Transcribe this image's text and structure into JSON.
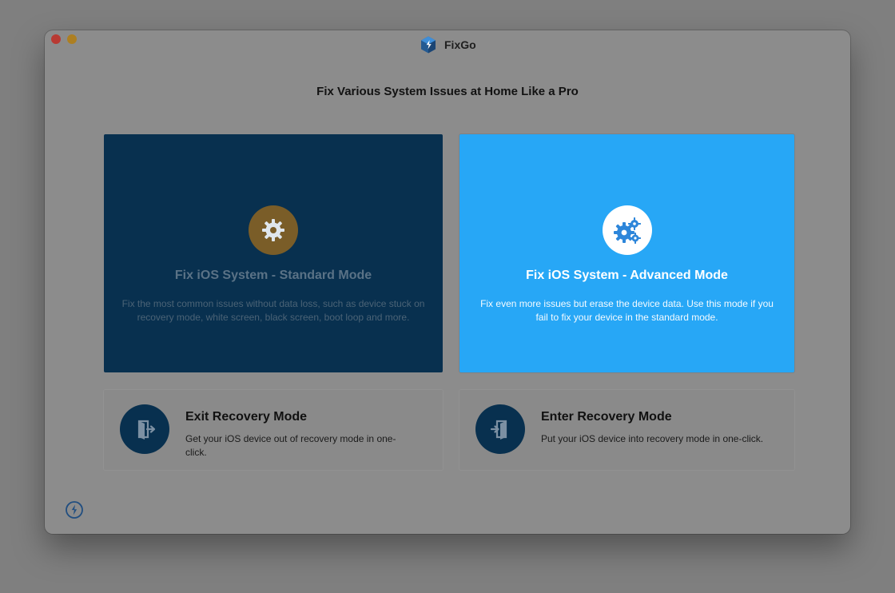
{
  "window": {
    "app_name": "FixGo"
  },
  "main": {
    "headline": "Fix Various System Issues at Home Like a Pro",
    "mode_cards": [
      {
        "title": "Fix iOS System - Standard Mode",
        "description": "Fix the most common issues without data loss, such as device stuck on recovery mode, white screen, black screen, boot loop and more.",
        "icon": "gear-icon",
        "accent_color": "#7a5d28"
      },
      {
        "title": "Fix iOS System - Advanced Mode",
        "description": "Fix even more issues but erase the device data. Use this mode if you fail to fix your device in the standard mode.",
        "icon": "double-gear-icon",
        "accent_color": "#27a7f6"
      }
    ],
    "recovery_cards": [
      {
        "title": "Exit Recovery Mode",
        "description": "Get your iOS device out of recovery mode in one-click.",
        "icon": "exit-door-icon"
      },
      {
        "title": "Enter Recovery Mode",
        "description": "Put your iOS device into recovery mode in one-click.",
        "icon": "enter-door-icon"
      }
    ]
  },
  "footer": {
    "icon": "lightning-icon"
  },
  "colors": {
    "backdrop": "#7f7f7f",
    "window_bg": "#8c8c8c",
    "standard_card_bg": "#08304f",
    "advanced_card_bg": "#27a7f6",
    "traffic_close": "#b83a33",
    "traffic_minimize": "#ad7f22"
  }
}
